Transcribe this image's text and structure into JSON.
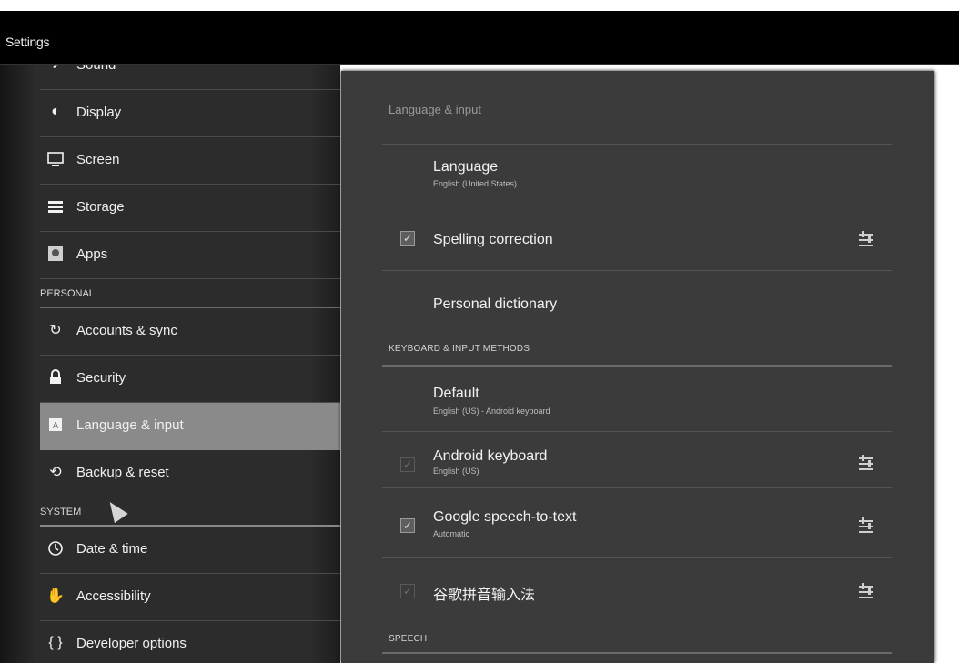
{
  "titlebar": {
    "title": "Settings"
  },
  "sidebar": {
    "top_partial": "Sound",
    "device_items": [
      {
        "label": "Display",
        "icon": "brightness-icon"
      },
      {
        "label": "Screen",
        "icon": "monitor-icon"
      },
      {
        "label": "Storage",
        "icon": "storage-icon"
      },
      {
        "label": "Apps",
        "icon": "apps-icon"
      }
    ],
    "personal_header": "PERSONAL",
    "personal_items": [
      {
        "label": "Accounts & sync",
        "icon": "sync-icon"
      },
      {
        "label": "Security",
        "icon": "lock-icon"
      },
      {
        "label": "Language & input",
        "icon": "language-icon"
      },
      {
        "label": "Backup & reset",
        "icon": "backup-icon"
      }
    ],
    "system_header": "SYSTEM",
    "system_items": [
      {
        "label": "Date & time",
        "icon": "clock-icon"
      },
      {
        "label": "Accessibility",
        "icon": "hand-icon"
      },
      {
        "label": "Developer options",
        "icon": "braces-icon"
      }
    ]
  },
  "panel": {
    "title": "Language & input",
    "language": {
      "title": "Language",
      "sub": "English (United States)"
    },
    "spelling": {
      "title": "Spelling correction",
      "checked": true
    },
    "dictionary": {
      "title": "Personal dictionary"
    },
    "keyboard_header": "KEYBOARD & INPUT METHODS",
    "default": {
      "title": "Default",
      "sub": "English (US) - Android keyboard"
    },
    "android_kb": {
      "title": "Android keyboard",
      "sub": "English (US)",
      "checked": true
    },
    "google_speech": {
      "title": "Google speech-to-text",
      "sub": "Automatic",
      "checked": true
    },
    "pinyin": {
      "title": "谷歌拼音输入法",
      "checked": true
    },
    "speech_header": "SPEECH"
  }
}
